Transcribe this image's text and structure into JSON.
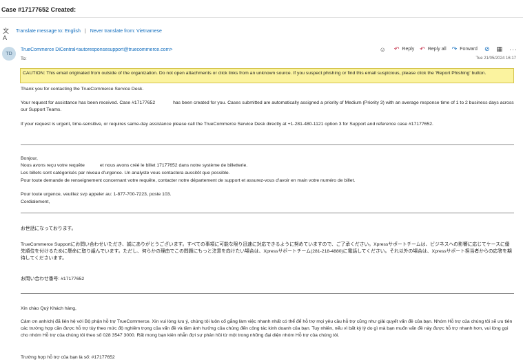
{
  "subject": "Case #17177652 Created:",
  "translate": {
    "translate_link": "Translate message to: English",
    "separator": "|",
    "never_link": "Never translate from: Vietnamese"
  },
  "sender": {
    "initials": "TD",
    "name_email": "TrueCommerce DiCentral<autoresponsesupport@truecommerce.com>",
    "to_label": "To:",
    "date": "Tue 21/05/2024 16:17"
  },
  "actions": {
    "reply": "Reply",
    "reply_all": "Reply all",
    "forward": "Forward"
  },
  "icons": [
    "translate-icon",
    "emoji-icon",
    "reply-icon",
    "reply-all-icon",
    "forward-icon",
    "sensitivity-icon",
    "apps-icon",
    "more-icon"
  ],
  "caution": "CAUTION: This email originated from outside of the organization. Do not open attachments or click links from an unknown source. If you suspect phishing or find this email suspicious, please click the 'Report Phishing' button.",
  "english": {
    "thanks": "Thank you for contacting the TrueCommerce Service Desk.",
    "request_a": "Your request for assistance has been received. Case #17177652",
    "request_b": "has been created for you. Cases submitted are automatically assigned a priority of Medium (Priority 3) with an average response time of 1 to 2 business days across our Support Teams.",
    "urgent": "If your request is urgent, time-sensitive, or requires same-day assistance please call the TrueCommerce Service Desk directly at +1-281-480-1121 option 3 for Support and reference case #17177652."
  },
  "french": {
    "greeting": "Bonjour,",
    "line1_a": "Nous avons reçu votre requête",
    "line1_b": "et nous avons créé le billet 17177652 dans notre système de billetterie.",
    "line2": "Les billets sont catégorisés par niveau d'urgence. Un analyste vous contactera aussitôt que possible.",
    "line3": "Pour toute demande de renseignement concernant votre requête, contacter notre département de support et assurez-vous d'avoir en main votre numéro de billet.",
    "line4": "Pour toute urgence, veuillez svp appeler au: 1-877-700-7223, poste 103.",
    "closing": "Cordialement,"
  },
  "japanese": {
    "greeting": "お世話になっております。",
    "body": "TrueCommerce Supportにお問い合わせいただき、誠にありがとうございます。すべての事項に可能な限り迅速に対応できるように努めていますので、ご了承ください。Xpressサポートチームは、ビジネスへの影響に応じてケースに優先順位を付けるために懸命に取り組んでいます。ただし、何らかの理由でこの問題にもっと注意を向けたい場合は、Xpressサポートチーム(281-218-4880)に電話してください。それ以外の場合は、Xpressサポート担当者からの応答を期待してくださいます。",
    "ticket": "お問い合わせ番号: #17177652"
  },
  "vietnamese": {
    "greeting": "Xin chào Quý Khách hàng,",
    "body": "Cảm ơn anh/chị đã liên hệ với Bộ phận hỗ trợ TrueCommerce. Xin vui lòng lưu ý, chúng tôi luôn cố gắng làm việc nhanh nhất có thể để hỗ trợ mọi yêu cầu hỗ trợ cũng như giải quyết vấn đề của bạn. Nhóm Hỗ trợ của chúng tôi sẽ ưu tiên các trường hợp cần được hỗ trợ tùy theo mức độ nghiêm trọng của vấn đề và tầm ảnh hưởng của chúng đến công tác kinh doanh của bạn. Tuy nhiên, nếu vì bất kỳ lý do gì mà bạn muốn vấn đề này được hỗ trợ nhanh hơn, vui lòng gọi cho nhóm Hỗ trợ của chúng tôi theo số 028 3547 3000. Rất mong bạn kiên nhẫn đợi sự phản hồi từ một trong những đại diện nhóm Hỗ trợ của chúng tôi.",
    "ticket": "Trường hợp hỗ trợ của bạn là số:  #17177652"
  }
}
